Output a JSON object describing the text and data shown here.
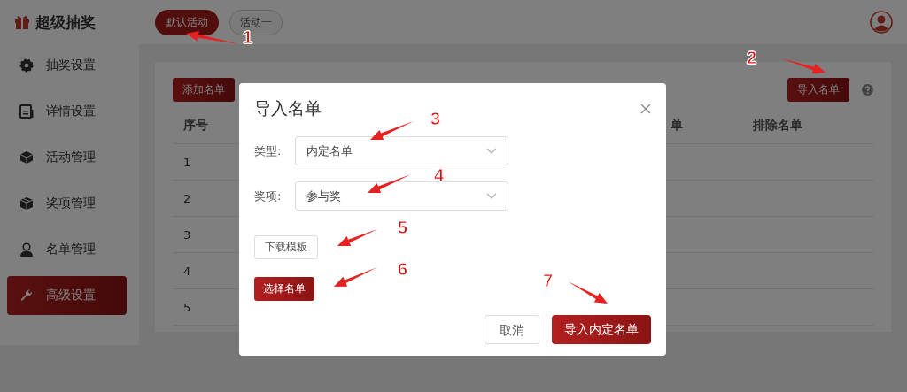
{
  "app": {
    "title": "超级抽奖"
  },
  "activity_tabs": [
    {
      "label": "默认活动",
      "selected": true
    },
    {
      "label": "活动一",
      "selected": false
    }
  ],
  "sidebar": {
    "items": [
      {
        "label": "抽奖设置",
        "kind": "gear",
        "selected": false
      },
      {
        "label": "详情设置",
        "kind": "document",
        "selected": false
      },
      {
        "label": "活动管理",
        "kind": "cube",
        "selected": false
      },
      {
        "label": "奖项管理",
        "kind": "box",
        "selected": false
      },
      {
        "label": "名单管理",
        "kind": "person",
        "selected": false
      },
      {
        "label": "高级设置",
        "kind": "wrench",
        "selected": true
      }
    ]
  },
  "toolbar": {
    "add_button": "添加名单",
    "import_button": "导入名单"
  },
  "table": {
    "columns": [
      "序号",
      "单",
      "排除名单"
    ],
    "rows": [
      [
        "1"
      ],
      [
        "2"
      ],
      [
        "3"
      ],
      [
        "4"
      ],
      [
        "5"
      ]
    ]
  },
  "dialog": {
    "title": "导入名单",
    "fields": [
      {
        "label": "类型:",
        "value": "内定名单"
      },
      {
        "label": "奖项:",
        "value": "参与奖"
      }
    ],
    "download_button": "下载模板",
    "choose_button": "选择名单",
    "cancel_button": "取消",
    "confirm_button": "导入内定名单"
  },
  "annotations": [
    "1",
    "2",
    "3",
    "4",
    "5",
    "6",
    "7"
  ]
}
